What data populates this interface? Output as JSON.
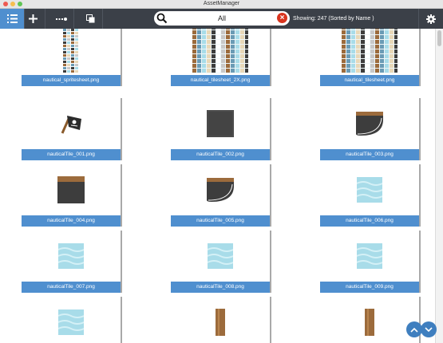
{
  "window": {
    "title": "AssetManager"
  },
  "toolbar": {
    "buttons": [
      {
        "icon": "list-view-icon",
        "active": true
      },
      {
        "icon": "plus-icon",
        "active": false
      },
      {
        "icon": "connect-icon",
        "active": false
      },
      {
        "icon": "duplicate-icon",
        "active": false
      }
    ],
    "search_value": "All",
    "status": "Showing: 247 (Sorted by Name )",
    "settings_icon": "gear-icon"
  },
  "assets": [
    {
      "name": "nautical_spritesheet.png",
      "thumb": "spritesheet-narrow"
    },
    {
      "name": "nautical_tilesheet_2X.png",
      "thumb": "tilesheet"
    },
    {
      "name": "nautical_tilesheet.png",
      "thumb": "tilesheet"
    },
    {
      "name": "nauticalTile_001.png",
      "thumb": "pirate-flag"
    },
    {
      "name": "nauticalTile_002.png",
      "thumb": "dark-square"
    },
    {
      "name": "nauticalTile_003.png",
      "thumb": "dark-curve"
    },
    {
      "name": "nauticalTile_004.png",
      "thumb": "dark-square-wood"
    },
    {
      "name": "nauticalTile_005.png",
      "thumb": "dark-curve-wood"
    },
    {
      "name": "nauticalTile_006.png",
      "thumb": "water"
    },
    {
      "name": "nauticalTile_007.png",
      "thumb": "water"
    },
    {
      "name": "nauticalTile_008.png",
      "thumb": "water"
    },
    {
      "name": "nauticalTile_009.png",
      "thumb": "water"
    },
    {
      "name": "",
      "thumb": "water"
    },
    {
      "name": "",
      "thumb": "post"
    },
    {
      "name": "",
      "thumb": "post"
    }
  ],
  "colors": {
    "accent": "#4f8fcf",
    "toolbar": "#3b4048",
    "clear": "#d9341e"
  }
}
